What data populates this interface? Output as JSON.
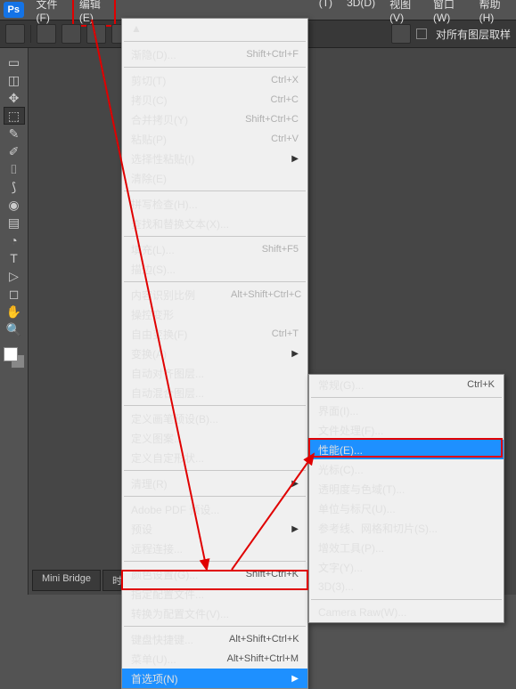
{
  "menubar": {
    "items": [
      "文件(F)",
      "编辑(E)",
      "(T)",
      "3D(D)",
      "视图(V)",
      "窗口(W)",
      "帮助(H)"
    ],
    "edit_index": 1
  },
  "toolbar": {
    "sample_label": "对所有图层取样"
  },
  "edit_menu": [
    {
      "label": "▲",
      "shortcut": "",
      "enabled": false,
      "arrow": false
    },
    {
      "sep": true
    },
    {
      "label": "渐隐(D)...",
      "shortcut": "Shift+Ctrl+F",
      "enabled": false
    },
    {
      "sep": true
    },
    {
      "label": "剪切(T)",
      "shortcut": "Ctrl+X",
      "enabled": false
    },
    {
      "label": "拷贝(C)",
      "shortcut": "Ctrl+C",
      "enabled": false
    },
    {
      "label": "合并拷贝(Y)",
      "shortcut": "Shift+Ctrl+C",
      "enabled": false
    },
    {
      "label": "粘贴(P)",
      "shortcut": "Ctrl+V",
      "enabled": false
    },
    {
      "label": "选择性粘贴(I)",
      "shortcut": "",
      "enabled": false,
      "arrow": true
    },
    {
      "label": "清除(E)",
      "shortcut": "",
      "enabled": false
    },
    {
      "sep": true
    },
    {
      "label": "拼写检查(H)...",
      "shortcut": "",
      "enabled": false
    },
    {
      "label": "查找和替换文本(X)...",
      "shortcut": "",
      "enabled": false
    },
    {
      "sep": true
    },
    {
      "label": "填充(L)...",
      "shortcut": "Shift+F5",
      "enabled": false
    },
    {
      "label": "描边(S)...",
      "shortcut": "",
      "enabled": false
    },
    {
      "sep": true
    },
    {
      "label": "内容识别比例",
      "shortcut": "Alt+Shift+Ctrl+C",
      "enabled": false
    },
    {
      "label": "操控变形",
      "shortcut": "",
      "enabled": false
    },
    {
      "label": "自由变换(F)",
      "shortcut": "Ctrl+T",
      "enabled": false
    },
    {
      "label": "变换(A)",
      "shortcut": "",
      "enabled": false,
      "arrow": true
    },
    {
      "label": "自动对齐图层...",
      "shortcut": "",
      "enabled": false
    },
    {
      "label": "自动混合图层...",
      "shortcut": "",
      "enabled": false
    },
    {
      "sep": true
    },
    {
      "label": "定义画笔预设(B)...",
      "shortcut": "",
      "enabled": false
    },
    {
      "label": "定义图案...",
      "shortcut": "",
      "enabled": false
    },
    {
      "label": "定义自定形状...",
      "shortcut": "",
      "enabled": false
    },
    {
      "sep": true
    },
    {
      "label": "清理(R)",
      "shortcut": "",
      "enabled": true,
      "arrow": true
    },
    {
      "sep": true
    },
    {
      "label": "Adobe PDF 预设...",
      "shortcut": "",
      "enabled": true
    },
    {
      "label": "预设",
      "shortcut": "",
      "enabled": true,
      "arrow": true
    },
    {
      "label": "远程连接...",
      "shortcut": "",
      "enabled": true
    },
    {
      "sep": true
    },
    {
      "label": "颜色设置(G)...",
      "shortcut": "Shift+Ctrl+K",
      "enabled": true
    },
    {
      "label": "指定配置文件...",
      "shortcut": "",
      "enabled": false
    },
    {
      "label": "转换为配置文件(V)...",
      "shortcut": "",
      "enabled": false
    },
    {
      "sep": true
    },
    {
      "label": "键盘快捷键...",
      "shortcut": "Alt+Shift+Ctrl+K",
      "enabled": true
    },
    {
      "label": "菜单(U)...",
      "shortcut": "Alt+Shift+Ctrl+M",
      "enabled": true
    },
    {
      "label": "首选项(N)",
      "shortcut": "",
      "enabled": true,
      "arrow": true,
      "hl": true
    }
  ],
  "pref_menu": [
    {
      "label": "常规(G)...",
      "shortcut": "Ctrl+K"
    },
    {
      "sep": true
    },
    {
      "label": "界面(I)..."
    },
    {
      "label": "文件处理(F)..."
    },
    {
      "label": "性能(E)...",
      "hl": true
    },
    {
      "label": "光标(C)..."
    },
    {
      "label": "透明度与色域(T)..."
    },
    {
      "label": "单位与标尺(U)..."
    },
    {
      "label": "参考线、网格和切片(S)..."
    },
    {
      "label": "增效工具(P)..."
    },
    {
      "label": "文字(Y)..."
    },
    {
      "label": "3D(3)..."
    },
    {
      "sep": true
    },
    {
      "label": "Camera Raw(W)..."
    }
  ],
  "bottom_tabs": [
    "Mini Bridge",
    "时间轴"
  ],
  "tools": [
    "▭",
    "◫",
    "✥",
    "⬚",
    "✎",
    "✐",
    "⌷",
    "⟆",
    "◉",
    "▤",
    "◔",
    "T",
    "▷",
    "◻",
    "✋",
    "🔍"
  ]
}
